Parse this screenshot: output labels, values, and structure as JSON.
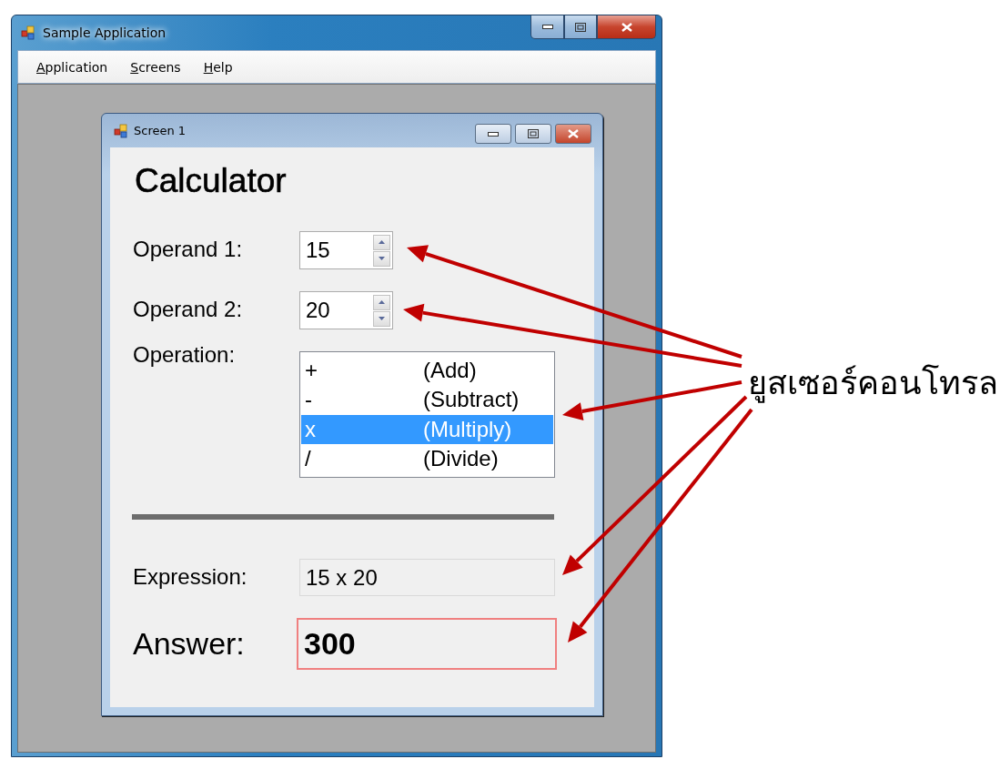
{
  "window": {
    "title": "Sample Application"
  },
  "menu": [
    {
      "label": "Application"
    },
    {
      "label": "Screens"
    },
    {
      "label": "Help"
    }
  ],
  "child_window": {
    "title": "Screen 1",
    "heading": "Calculator",
    "operand_1": {
      "label": "Operand 1:",
      "value": "15"
    },
    "operand_2": {
      "label": "Operand 2:",
      "value": "20"
    },
    "operation": {
      "label": "Operation:",
      "items": [
        {
          "symbol": "+",
          "name": "(Add)",
          "selected": false
        },
        {
          "symbol": "-",
          "name": "(Subtract)",
          "selected": false
        },
        {
          "symbol": "x",
          "name": "(Multiply)",
          "selected": true
        },
        {
          "symbol": "/",
          "name": "(Divide)",
          "selected": false
        }
      ]
    },
    "expression": {
      "label": "Expression:",
      "value": "15 x 20"
    },
    "answer": {
      "label": "Answer:",
      "value": "300"
    }
  },
  "annotation": {
    "label": "ยูสเซอร์คอนโทรล"
  }
}
